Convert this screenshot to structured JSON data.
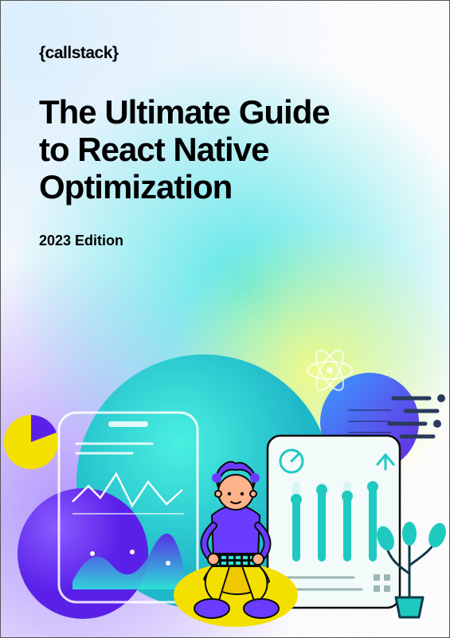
{
  "logo": "{callstack}",
  "title_line1": "The Ultimate Guide",
  "title_line2": "to React Native",
  "title_line3": "Optimization",
  "edition": "2023 Edition",
  "colors": {
    "purple": "#6a3cff",
    "violet": "#7a2cff",
    "deep_purple": "#4b1fd6",
    "cyan": "#2fe6d8",
    "teal": "#1fc9c0",
    "yellow": "#f3e000",
    "dark": "#0a0a0a",
    "white": "#ffffff",
    "offwhite": "#eaf8f7"
  }
}
